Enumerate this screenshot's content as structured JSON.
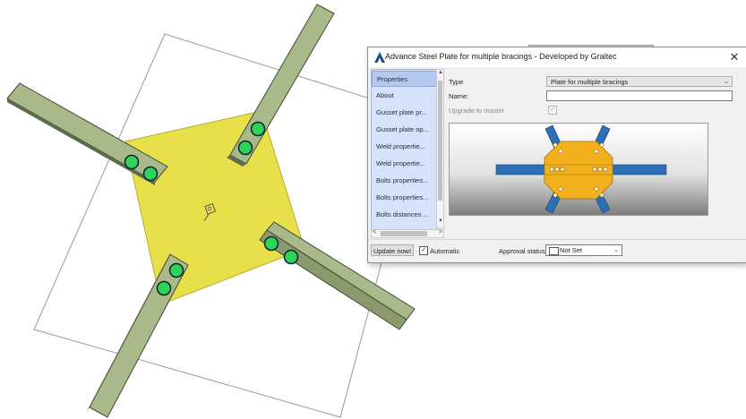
{
  "dialog": {
    "title": "Advance Steel   Plate for multiple bracings - Developed by Graitec",
    "close_glyph": "✕"
  },
  "tree": {
    "items": [
      {
        "label": "Properties",
        "selected": true
      },
      {
        "label": "About",
        "selected": false
      },
      {
        "label": "Gusset plate pr...",
        "selected": false
      },
      {
        "label": "Gusset plate op...",
        "selected": false
      },
      {
        "label": "Weld propertie...",
        "selected": false
      },
      {
        "label": "Weld propertie...",
        "selected": false
      },
      {
        "label": "Bolts properties...",
        "selected": false
      },
      {
        "label": "Bolts properties...",
        "selected": false
      },
      {
        "label": "Bolts distances ...",
        "selected": false
      }
    ]
  },
  "form": {
    "type_label": "Type",
    "type_value": "Plate for multiple bracings",
    "name_label": "Name:",
    "name_value": "",
    "upgrade_label": "Upgrade to master",
    "upgrade_checked": true
  },
  "footer": {
    "update_button": "Update now!",
    "automatic_label": "Automatic",
    "automatic_checked": true,
    "approval_label": "Approval status",
    "approval_value": "Not Set"
  },
  "glyphs": {
    "check": "✓",
    "dropdown": "⌄",
    "scroll_up": "▲",
    "scroll_down": "▼",
    "scroll_left": "<",
    "scroll_right": ">"
  },
  "colors": {
    "plate_yellow": "#e8e04a",
    "brace_green": "#a9b98a",
    "bolt_green": "#2ed35a",
    "preview_blue": "#2c6fb5",
    "preview_orange": "#f2b01e",
    "tree_blue": "#d5e2fa"
  }
}
